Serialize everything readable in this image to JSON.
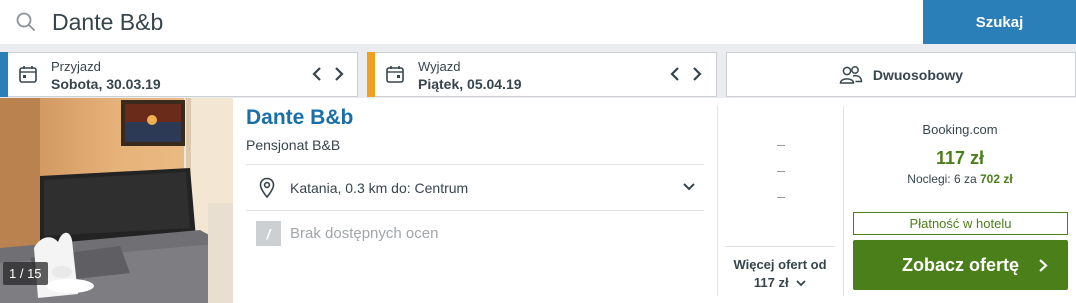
{
  "search": {
    "value": "Dante B&b",
    "button_label": "Szukaj",
    "icon": "search-icon"
  },
  "checkin": {
    "label": "Przyjazd",
    "date": "Sobota, 30.03.19",
    "accent_color": "#2a7fb8"
  },
  "checkout": {
    "label": "Wyjazd",
    "date": "Piątek, 05.04.19",
    "accent_color": "#f0a01e"
  },
  "room": {
    "label": "Dwuosobowy",
    "icon": "people-icon"
  },
  "hotel": {
    "name": "Dante B&b",
    "type": "Pensjonat B&B",
    "location": "Katania, 0.3 km do: Centrum",
    "rating_badge": "/",
    "rating_text": "Brak dostępnych ocen",
    "photo_counter": "1 / 15"
  },
  "offers": {
    "more_label": "Więcej ofert od",
    "more_price": "117 zł"
  },
  "deal": {
    "provider": "Booking.com",
    "price": "117 zł",
    "nights_prefix": "Noclegi: 6 za",
    "nights_total": "702 zł",
    "payment_badge": "Płatność w hotelu",
    "cta_label": "Zobacz ofertę",
    "price_color": "#4a7f1a"
  }
}
